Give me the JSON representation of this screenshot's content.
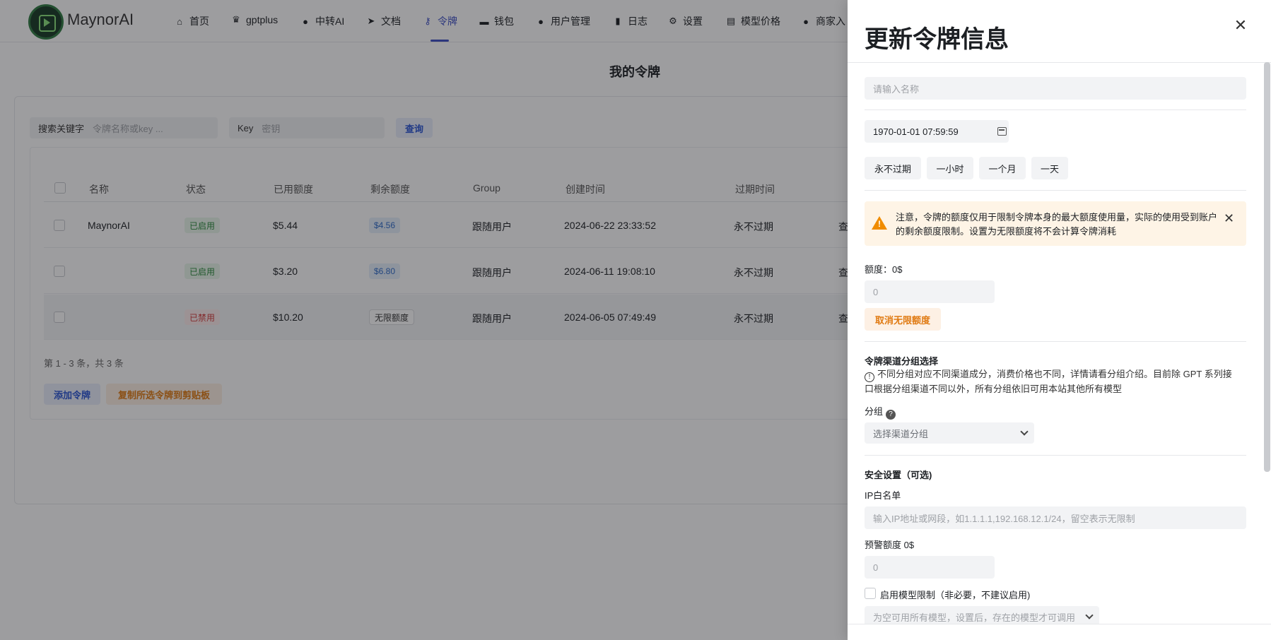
{
  "nav": {
    "brand": "MaynorAI",
    "items": [
      {
        "label": "首页",
        "icon": "home-icon"
      },
      {
        "label": "gptplus",
        "icon": "crown-icon"
      },
      {
        "label": "中转AI",
        "icon": "chat-icon"
      },
      {
        "label": "文档",
        "icon": "send-icon"
      },
      {
        "label": "令牌",
        "icon": "key-icon"
      },
      {
        "label": "钱包",
        "icon": "wallet-icon"
      },
      {
        "label": "用户管理",
        "icon": "user-icon"
      },
      {
        "label": "日志",
        "icon": "bar-chart-icon"
      },
      {
        "label": "设置",
        "icon": "gear-icon"
      },
      {
        "label": "模型价格",
        "icon": "price-icon"
      },
      {
        "label": "商家入",
        "icon": "users-icon"
      }
    ],
    "active": "令牌"
  },
  "page": {
    "title": "我的令牌",
    "search_label": "搜索关键字",
    "search_placeholder": "令牌名称或key ...",
    "key_label": "Key",
    "key_placeholder": "密钥",
    "query_button": "查询",
    "pager": "第 1 - 3 条，共 3 条",
    "add_button": "添加令牌",
    "copy_button": "复制所选令牌到剪贴板"
  },
  "table": {
    "columns": [
      "名称",
      "状态",
      "已用额度",
      "剩余额度",
      "Group",
      "创建时间",
      "过期时间"
    ],
    "rows": [
      {
        "name": "MaynorAI",
        "status": "已启用",
        "used": "$5.44",
        "remaining": "$4.56",
        "group": "跟随用户",
        "created": "2024-06-22 23:33:52",
        "expires": "永不过期",
        "action": "查"
      },
      {
        "name": "",
        "status": "已启用",
        "used": "$3.20",
        "remaining": "$6.80",
        "group": "跟随用户",
        "created": "2024-06-11 19:08:10",
        "expires": "永不过期",
        "action": "查"
      },
      {
        "name": "",
        "status": "已禁用",
        "used": "$10.20",
        "remaining": "无限额度",
        "group": "跟随用户",
        "created": "2024-06-05 07:49:49",
        "expires": "永不过期",
        "action": "查"
      }
    ]
  },
  "sheet": {
    "title": "更新令牌信息",
    "name_placeholder": "请输入名称",
    "expire_value": "1970-01-01 07:59:59",
    "quick_buttons": [
      "永不过期",
      "一小时",
      "一个月",
      "一天"
    ],
    "warning": "注意，令牌的额度仅用于限制令牌本身的最大额度使用量，实际的使用受到账户的剩余额度限制。设置为无限额度将不会计算令牌消耗",
    "quota_label": "额度：0$",
    "quota_placeholder": "0",
    "unlimited_button": "取消无限额度",
    "group_section_title": "令牌渠道分组选择",
    "group_help": "不同分组对应不同渠道成分，消费价格也不同，详情请看分组介绍。目前除 GPT 系列接口根据分组渠道不同以外，所有分组依旧可用本站其他所有模型",
    "group_label": "分组",
    "group_placeholder": "选择渠道分组",
    "security_title": "安全设置（可选)",
    "ip_label": "IP白名单",
    "ip_placeholder": "输入IP地址或网段，如1.1.1.1,192.168.12.1/24，留空表示无限制",
    "alert_label": "预警额度 0$",
    "alert_placeholder": "0",
    "model_limit_label": "启用模型限制（非必要，不建议启用)",
    "model_placeholder": "为空可用所有模型，设置后，存在的模型才可调用"
  },
  "colors": {
    "accent": "#3d4fc4",
    "orange": "#e07a12",
    "warning_bg": "#fef4e6",
    "success": "#2a8a3c",
    "danger": "#d23b3b"
  }
}
